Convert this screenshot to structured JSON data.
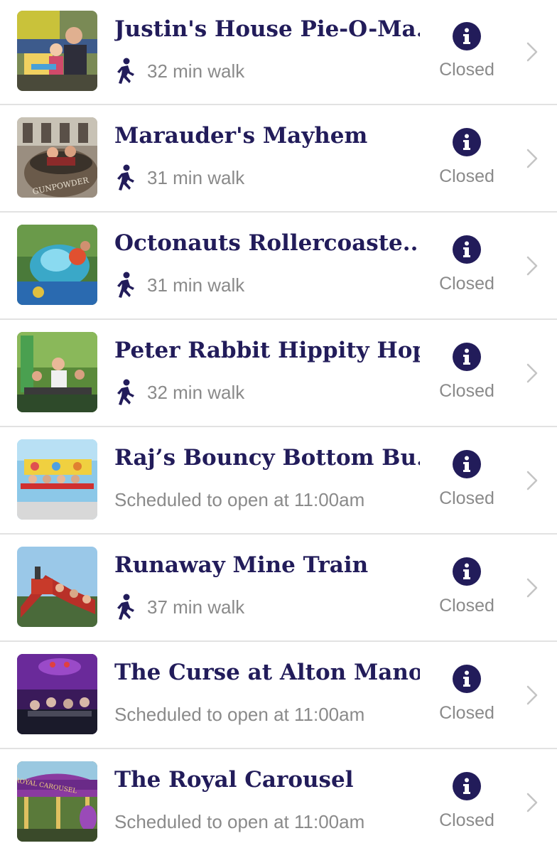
{
  "rides": [
    {
      "name": "Justin's House Pie-O-Ma...",
      "subtitle": "32 min walk",
      "show_walk_icon": true,
      "status": "Closed",
      "thumb": "family-ride-photo"
    },
    {
      "name": "Marauder's Mayhem",
      "subtitle": "31 min walk",
      "show_walk_icon": true,
      "status": "Closed",
      "thumb": "gunpowder-barrel-ride-photo",
      "thumb_text": "GUNPOWDER"
    },
    {
      "name": "Octonauts Rollercoaste...",
      "subtitle": "31 min walk",
      "show_walk_icon": true,
      "status": "Closed",
      "thumb": "octopus-coaster-photo"
    },
    {
      "name": "Peter Rabbit Hippity Hop",
      "subtitle": "32 min walk",
      "show_walk_icon": true,
      "status": "Closed",
      "thumb": "hippity-hop-ride-photo"
    },
    {
      "name": "Raj’s Bouncy Bottom Bu...",
      "subtitle": "Scheduled to open at 11:00am",
      "show_walk_icon": false,
      "status": "Closed",
      "thumb": "bouncy-bottom-ride-photo"
    },
    {
      "name": "Runaway Mine Train",
      "subtitle": "37 min walk",
      "show_walk_icon": true,
      "status": "Closed",
      "thumb": "mine-train-photo"
    },
    {
      "name": "The Curse at Alton Manor",
      "subtitle": "Scheduled to open at 11:00am",
      "show_walk_icon": false,
      "status": "Closed",
      "thumb": "dark-ride-photo"
    },
    {
      "name": "The Royal Carousel",
      "subtitle": "Scheduled to open at 11:00am",
      "show_walk_icon": false,
      "status": "Closed",
      "thumb": "carousel-photo",
      "thumb_text": "ROYAL CAROUSEL"
    }
  ],
  "colors": {
    "title": "#221c5a",
    "secondary_text": "#8a8a8a",
    "info_button": "#221c5a",
    "divider": "#e2e2e2",
    "chevron": "#c4c4c4"
  },
  "icons": {
    "walk": "walking-person-icon",
    "info": "info-icon",
    "chevron": "chevron-right-icon"
  }
}
